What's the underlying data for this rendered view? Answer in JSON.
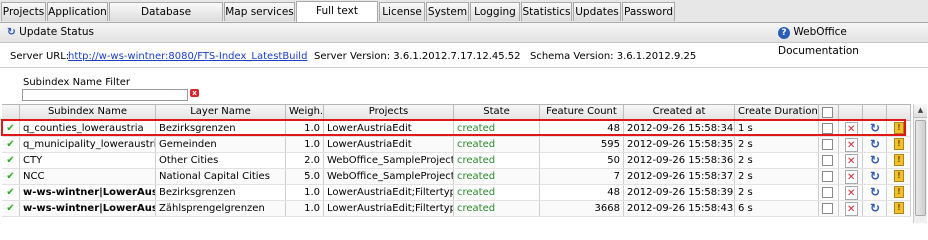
{
  "tabs": [
    "Projects",
    "Application",
    "Database connections",
    "Map services",
    "Full text Search",
    "License",
    "System",
    "Logging",
    "Statistics",
    "Updates",
    "Password"
  ],
  "active_tab": "Full text Search",
  "toolbar": {
    "update_status": "Update Status",
    "documentation": "WebOffice Documentation"
  },
  "info": {
    "server_url_label": "Server URL:",
    "server_url": "http://w-ws-wintner:8080/FTS-Index_LatestBuild",
    "server_version": "Server Version: 3.6.1.2012.7.17.12.45.52",
    "schema_version": "Schema Version: 3.6.1.2012.9.25"
  },
  "filter": {
    "label": "Subindex Name Filter",
    "value": ""
  },
  "grid": {
    "headers": [
      "Subindex Name",
      "Layer Name",
      "Weigh.",
      "Projects",
      "State",
      "Feature Count",
      "Created at",
      "Create Duration"
    ],
    "rows": [
      {
        "name": "q_counties_loweraustria",
        "layer": "Bezirksgrenzen",
        "weight": "1.0",
        "projects": "LowerAustriaEdit",
        "state": "created",
        "count": "48",
        "created": "2012-09-26 15:58:34",
        "duration": "1 s",
        "bold": false
      },
      {
        "name": "q_municipality_loweraustria",
        "layer": "Gemeinden",
        "weight": "1.0",
        "projects": "LowerAustriaEdit",
        "state": "created",
        "count": "595",
        "created": "2012-09-26 15:58:35",
        "duration": "2 s",
        "bold": false
      },
      {
        "name": "CTY",
        "layer": "Other Cities",
        "weight": "2.0",
        "projects": "WebOffice_SampleProject",
        "state": "created",
        "count": "50",
        "created": "2012-09-26 15:58:36",
        "duration": "2 s",
        "bold": false
      },
      {
        "name": "NCC",
        "layer": "National Capital Cities",
        "weight": "5.0",
        "projects": "WebOffice_SampleProject",
        "state": "created",
        "count": "7",
        "created": "2012-09-26 15:58:37",
        "duration": "2 s",
        "bold": false
      },
      {
        "name": "w-ws-wintner|LowerAustri",
        "layer": "Bezirksgrenzen",
        "weight": "1.0",
        "projects": "LowerAustriaEdit;Filtertype",
        "state": "created",
        "count": "48",
        "created": "2012-09-26 15:58:39",
        "duration": "2 s",
        "bold": true
      },
      {
        "name": "w-ws-wintner|LowerAustri",
        "layer": "Zählsprengelgrenzen",
        "weight": "1.0",
        "projects": "LowerAustriaEdit;Filtertype",
        "state": "created",
        "count": "3668",
        "created": "2012-09-26 15:58:43",
        "duration": "6 s",
        "bold": true
      }
    ]
  }
}
